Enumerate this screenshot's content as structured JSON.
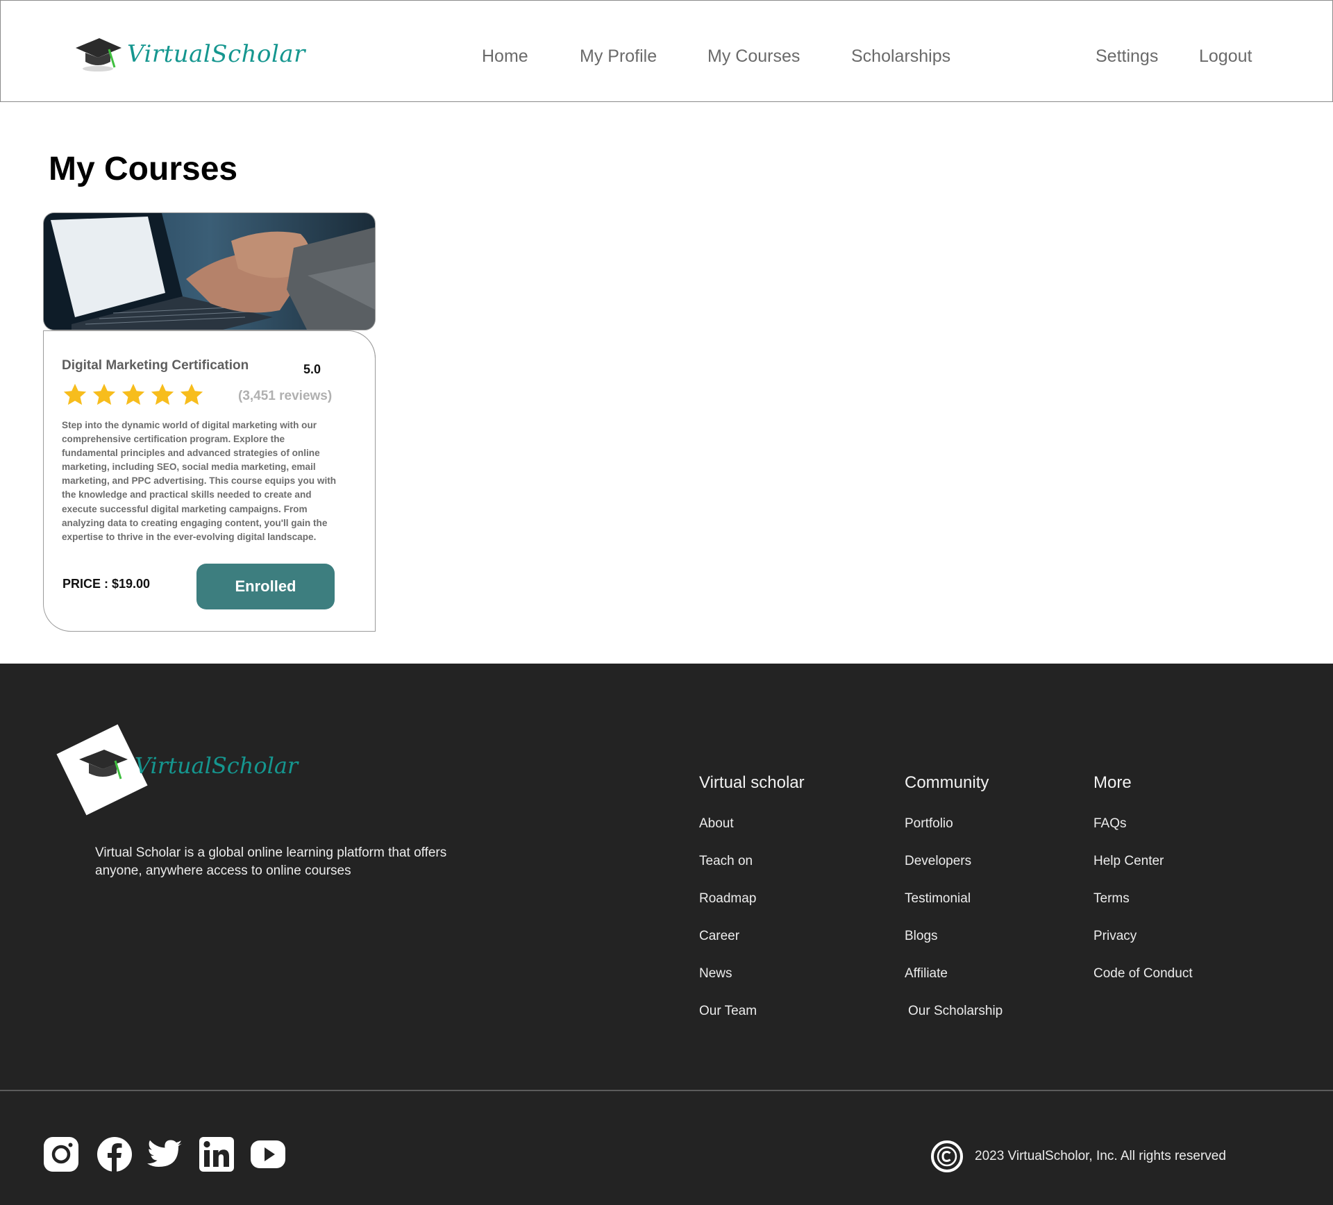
{
  "brand": {
    "name": "VirtualScholar",
    "accent": "#15968f"
  },
  "nav": {
    "home": "Home",
    "profile": "My Profile",
    "courses": "My Courses",
    "scholarships": "Scholarships",
    "settings": "Settings",
    "logout": "Logout"
  },
  "main": {
    "title": "My Courses",
    "course": {
      "title": "Digital Marketing Certification",
      "rating": "5.0",
      "stars": 5,
      "reviews": "(3,451 reviews)",
      "description": "Step into the dynamic world of digital marketing with our comprehensive certification program. Explore the fundamental principles and advanced strategies of online marketing, including SEO, social media marketing, email marketing, and PPC advertising. This course equips you with the knowledge and practical skills needed to create and execute successful digital marketing campaigns. From analyzing data to creating engaging content, you'll gain the expertise to thrive in the ever-evolving digital landscape.",
      "price": "PRICE : $19.00",
      "button": "Enrolled",
      "button_color": "#3d7e7f"
    }
  },
  "footer": {
    "about": "Virtual Scholar is a global online learning platform that offers anyone, anywhere access to online courses",
    "columns": [
      {
        "heading": "Virtual scholar",
        "links": [
          "About",
          "Teach on",
          "Roadmap",
          "Career",
          "News",
          "Our Team"
        ]
      },
      {
        "heading": "Community",
        "links": [
          "Portfolio",
          "Developers",
          "Testimonial",
          "Blogs",
          "Affiliate",
          "Our Scholarship"
        ]
      },
      {
        "heading": "More",
        "links": [
          "FAQs",
          "Help Center",
          "Terms",
          "Privacy",
          "Code of Conduct"
        ]
      }
    ],
    "social": [
      "instagram-icon",
      "facebook-icon",
      "twitter-icon",
      "linkedin-icon",
      "youtube-icon"
    ],
    "copyright": "2023 VirtualScholor, Inc. All rights reserved",
    "background": "#232323"
  }
}
